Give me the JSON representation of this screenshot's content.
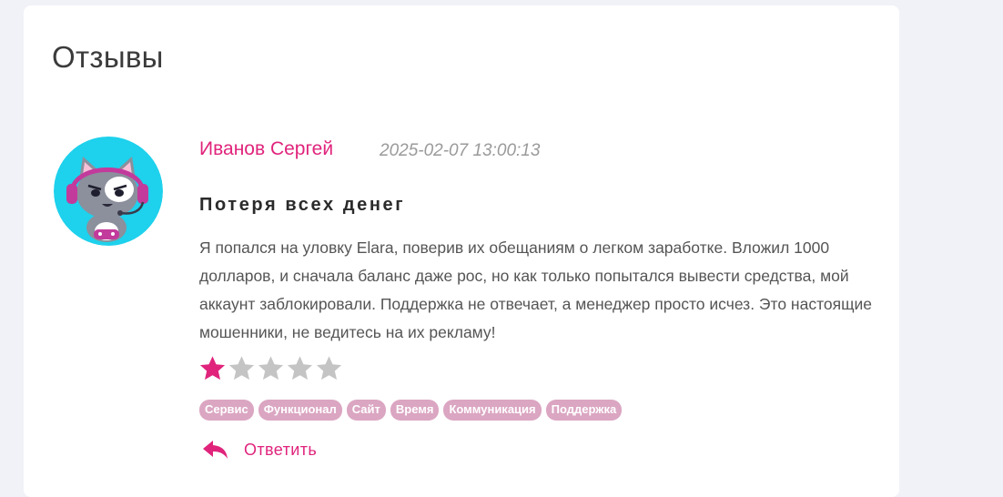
{
  "section": {
    "title": "Отзывы"
  },
  "review": {
    "author": "Иванов Сергей",
    "date": "2025-02-07 13:00:13",
    "title": "Потеря всех денег",
    "text": "Я попался на уловку Elara, поверив их обещаниям о легком заработке. Вложил 1000 долларов, и сначала баланс даже рос, но как только попытался вывести средства, мой аккаунт заблокировали. Поддержка не отвечает, а менеджер просто исчез. Это настоящие мошенники, не ведитесь на их рекламу!",
    "rating": 1,
    "rating_max": 5,
    "tags": [
      "Сервис",
      "Функционал",
      "Сайт",
      "Время",
      "Коммуникация",
      "Поддержка"
    ],
    "reply_label": "Ответить",
    "avatar_icon": "cat-gamer-avatar"
  },
  "colors": {
    "accent": "#e0247c",
    "star_filled": "#e0247c",
    "star_empty": "#c4c4c4",
    "tag_bg": "#dba6c2",
    "page_bg": "#f1f2f7",
    "avatar_bg": "#1ed1ec"
  }
}
